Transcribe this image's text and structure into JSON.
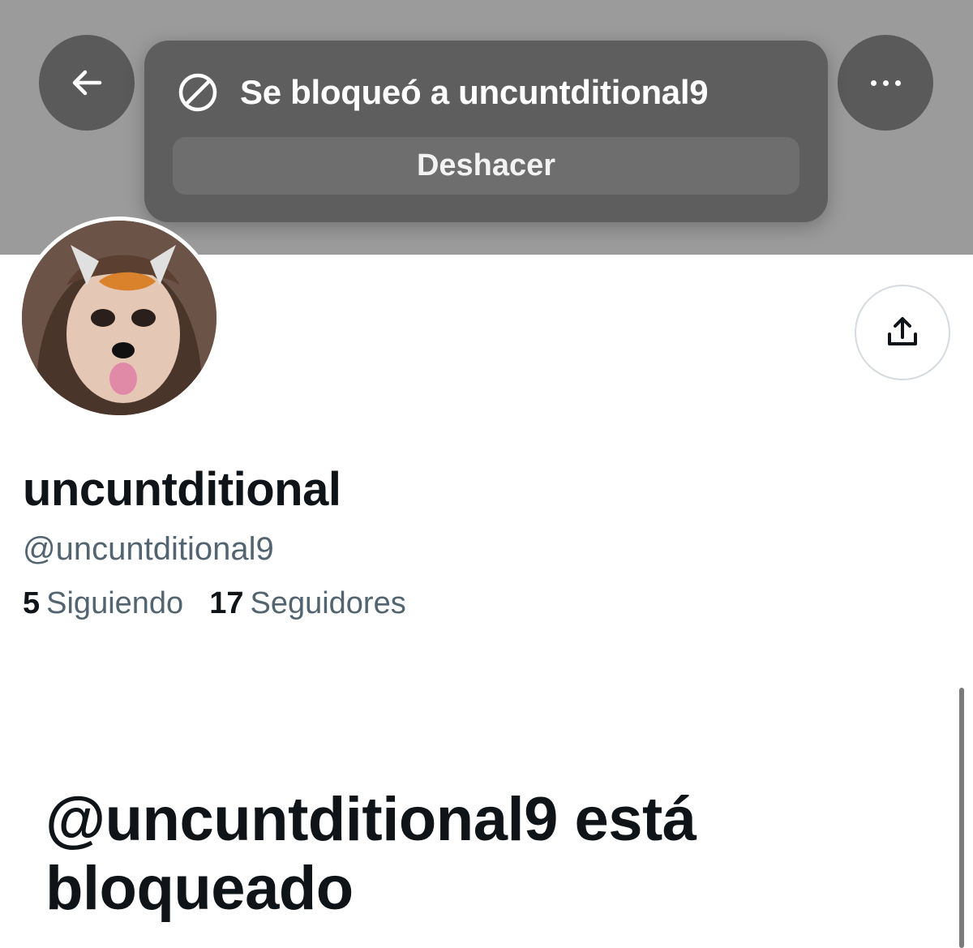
{
  "toast": {
    "message": "Se bloqueó a uncuntditional9",
    "undo_label": "Deshacer"
  },
  "profile": {
    "display_name": "uncuntditional",
    "handle": "@uncuntditional9",
    "following_count": "5",
    "following_label": "Siguiendo",
    "followers_count": "17",
    "followers_label": "Seguidores"
  },
  "blocked_notice": {
    "title": "@uncuntditional9 está bloqueado"
  },
  "icons": {
    "back": "arrow-left-icon",
    "more": "more-horizontal-icon",
    "block": "block-icon",
    "share": "share-icon"
  },
  "colors": {
    "banner": "#9b9b9b",
    "toast_bg": "#5e5e5e",
    "text_primary": "#0f1419",
    "text_secondary": "#536471"
  }
}
